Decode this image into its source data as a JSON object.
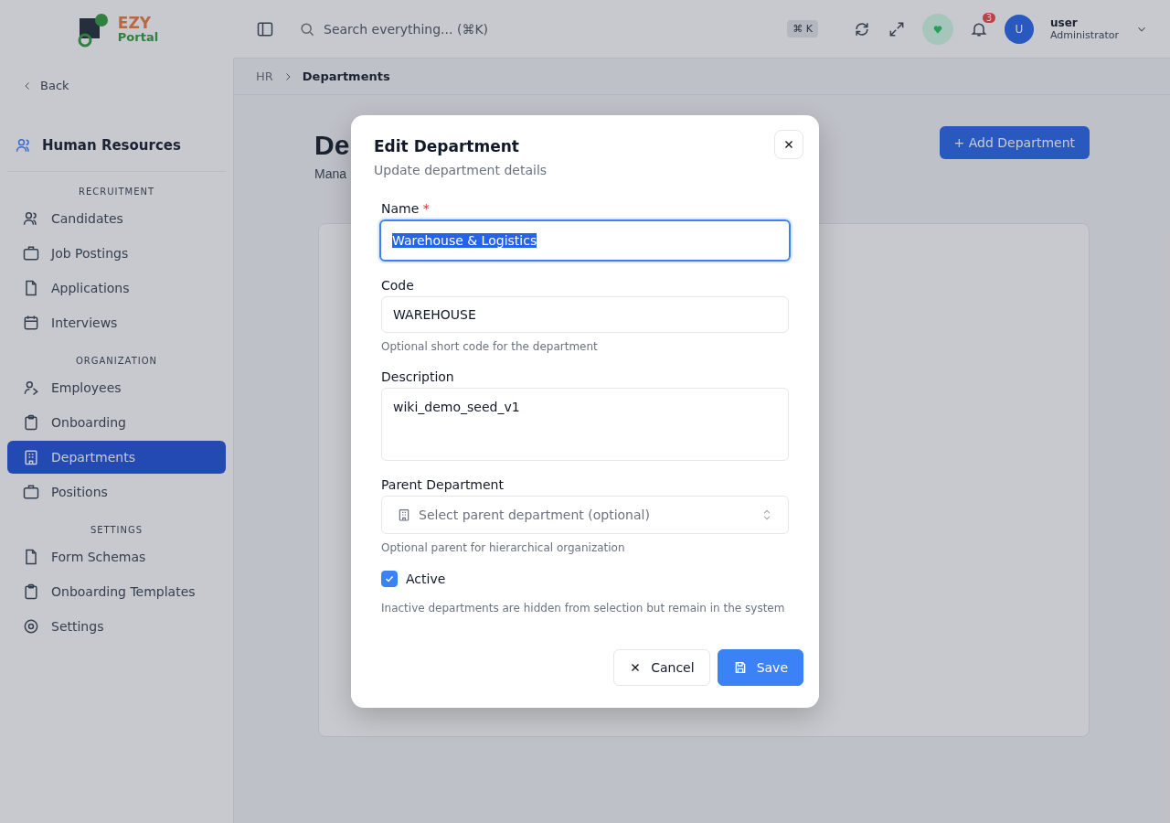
{
  "header": {
    "logo": {
      "line1": "EZY",
      "line2": "Portal"
    },
    "search": {
      "placeholder": "Search everything... (⌘K)",
      "shortcut": "⌘ K"
    },
    "notifications": {
      "count": "3"
    },
    "user": {
      "initial": "U",
      "name": "user",
      "role": "Administrator"
    }
  },
  "breadcrumb": [
    {
      "label": "HR"
    },
    {
      "label": "Departments"
    }
  ],
  "sidebar": {
    "back": "Back",
    "module": "Human Resources",
    "sections": [
      {
        "title": "RECRUITMENT",
        "items": [
          {
            "label": "Candidates",
            "selected": false
          },
          {
            "label": "Job Postings",
            "selected": false
          },
          {
            "label": "Applications",
            "selected": false
          },
          {
            "label": "Interviews",
            "selected": false
          }
        ]
      },
      {
        "title": "ORGANIZATION",
        "items": [
          {
            "label": "Employees",
            "selected": false
          },
          {
            "label": "Onboarding",
            "selected": false
          },
          {
            "label": "Departments",
            "selected": true
          },
          {
            "label": "Positions",
            "selected": false
          }
        ]
      },
      {
        "title": "SETTINGS",
        "items": [
          {
            "label": "Form Schemas",
            "selected": false
          },
          {
            "label": "Onboarding Templates",
            "selected": false
          },
          {
            "label": "Settings",
            "selected": false
          }
        ]
      }
    ]
  },
  "page": {
    "title": "De",
    "subtitle": "Mana",
    "add_button": "+ Add Department"
  },
  "dialog": {
    "title": "Edit Department",
    "subtitle": "Update department details",
    "fields": [
      {
        "kind": "text",
        "label": "Name",
        "required_mark": "*",
        "value": "Warehouse & Logistics",
        "focused": true,
        "value_selected": true
      },
      {
        "kind": "text",
        "label": "Code",
        "value": "WAREHOUSE",
        "focused": false,
        "value_selected": false,
        "help": "Optional short code for the department"
      },
      {
        "kind": "textarea",
        "label": "Description",
        "value": "wiki_demo_seed_v1"
      },
      {
        "kind": "select",
        "label": "Parent Department",
        "placeholder": "Select parent department (optional)",
        "help": "Optional parent for hierarchical organization"
      },
      {
        "kind": "checkbox",
        "label": "Active",
        "checked": true,
        "help": "Inactive departments are hidden from selection but remain in the system"
      }
    ],
    "buttons": [
      {
        "kind": "cancel",
        "label": "Cancel"
      },
      {
        "kind": "save",
        "label": "Save"
      }
    ]
  }
}
